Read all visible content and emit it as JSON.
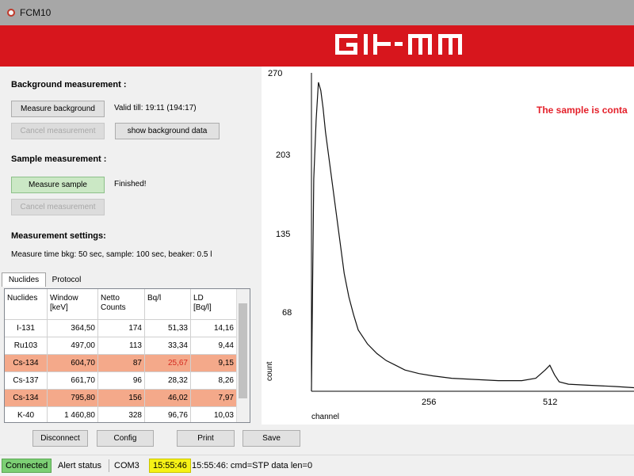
{
  "window": {
    "title": "FCM10"
  },
  "logo": {
    "text": "GI-MM",
    "color": "#ffffff"
  },
  "colors": {
    "brand_red": "#d7161d",
    "highlight_row": "#f4a98a",
    "active_green": "#cbe8c5",
    "status_yellow": "#f6f216",
    "alert_red": "#e4202a"
  },
  "background": {
    "section_title": "Background measurement :",
    "measure_button": "Measure background",
    "valid_till": "Valid till: 19:11 (194:17)",
    "cancel_button": "Cancel measurement",
    "show_data_button": "show background data"
  },
  "sample": {
    "section_title": "Sample measurement :",
    "measure_button": "Measure sample",
    "status": "Finished!",
    "cancel_button": "Cancel measurement"
  },
  "settings": {
    "section_title": "Measurement settings:",
    "summary": "Measure time bkg: 50 sec, sample: 100 sec, beaker: 0.5 l"
  },
  "tabs": [
    "Nuclides",
    "Protocol"
  ],
  "nuclide_table": {
    "headers": [
      "Nuclides",
      "Window\n[keV]",
      "Netto\nCounts",
      "Bq/l",
      "LD\n[Bq/l]"
    ],
    "rows": [
      {
        "cells": [
          "I-131",
          "364,50",
          "174",
          "51,33",
          "14,16"
        ],
        "highlight": false
      },
      {
        "cells": [
          "Ru103",
          "497,00",
          "113",
          "33,34",
          "9,44"
        ],
        "highlight": false
      },
      {
        "cells": [
          "Cs-134",
          "604,70",
          "87",
          "25,67",
          "9,15"
        ],
        "highlight": true,
        "red_col": 3
      },
      {
        "cells": [
          "Cs-137",
          "661,70",
          "96",
          "28,32",
          "8,26"
        ],
        "highlight": false
      },
      {
        "cells": [
          "Cs-134",
          "795,80",
          "156",
          "46,02",
          "7,97"
        ],
        "highlight": true
      },
      {
        "cells": [
          "K-40",
          "1 460,80",
          "328",
          "96,76",
          "10,03"
        ],
        "highlight": false
      }
    ]
  },
  "chart_data": {
    "type": "line",
    "alert_text": "The sample is conta",
    "xlabel": "channel",
    "ylabel": "count",
    "x_ticks": [
      "256",
      "512"
    ],
    "y_ticks": [
      "270",
      "203",
      "135",
      "68"
    ],
    "xlim": [
      0,
      690
    ],
    "ylim": [
      0,
      270
    ],
    "series": [
      {
        "x": [
          0,
          5,
          10,
          15,
          20,
          25,
          30,
          40,
          50,
          60,
          70,
          80,
          90,
          100,
          120,
          140,
          160,
          180,
          200,
          230,
          260,
          300,
          350,
          400,
          450,
          480,
          500,
          510,
          520,
          530,
          550,
          600,
          650,
          690
        ],
        "values": [
          0,
          180,
          230,
          262,
          255,
          240,
          220,
          190,
          160,
          130,
          100,
          80,
          65,
          52,
          40,
          32,
          26,
          22,
          18,
          15,
          13,
          11,
          10,
          9,
          9,
          11,
          18,
          22,
          14,
          8,
          6,
          5,
          4,
          3
        ]
      }
    ]
  },
  "bottom_buttons": {
    "disconnect": "Disconnect",
    "config": "Config",
    "print": "Print",
    "save": "Save"
  },
  "status": {
    "connected": "Connected",
    "alert": "Alert status",
    "port": "COM3",
    "time": "15:55:46",
    "message": "15:55:46: cmd=STP data len=0"
  }
}
